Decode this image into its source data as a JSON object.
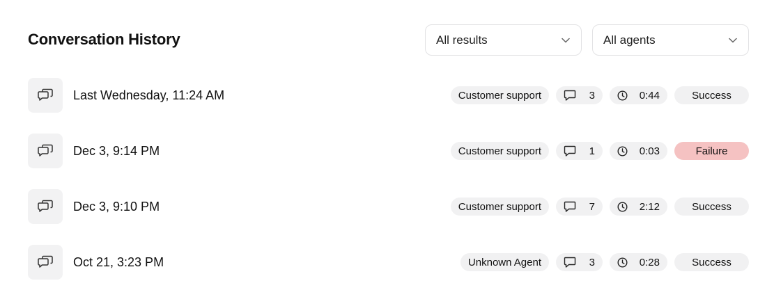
{
  "header": {
    "title": "Conversation History",
    "results_filter": "All results",
    "agents_filter": "All agents"
  },
  "conversations": [
    {
      "date": "Last Wednesday, 11:24 AM",
      "agent": "Customer support",
      "messages": "3",
      "duration": "0:44",
      "status": "Success"
    },
    {
      "date": "Dec 3, 9:14 PM",
      "agent": "Customer support",
      "messages": "1",
      "duration": "0:03",
      "status": "Failure"
    },
    {
      "date": "Dec 3, 9:10 PM",
      "agent": "Customer support",
      "messages": "7",
      "duration": "2:12",
      "status": "Success"
    },
    {
      "date": "Oct 21, 3:23 PM",
      "agent": "Unknown Agent",
      "messages": "3",
      "duration": "0:28",
      "status": "Success"
    }
  ],
  "colors": {
    "pill_background": "#f1f1f2",
    "failure_background": "#f5c2c2",
    "icon_tile_background": "#f2f2f3"
  },
  "icons": {
    "row": "conversation-icon",
    "messages": "message-icon",
    "duration": "clock-icon",
    "dropdown": "chevron-down-icon"
  }
}
